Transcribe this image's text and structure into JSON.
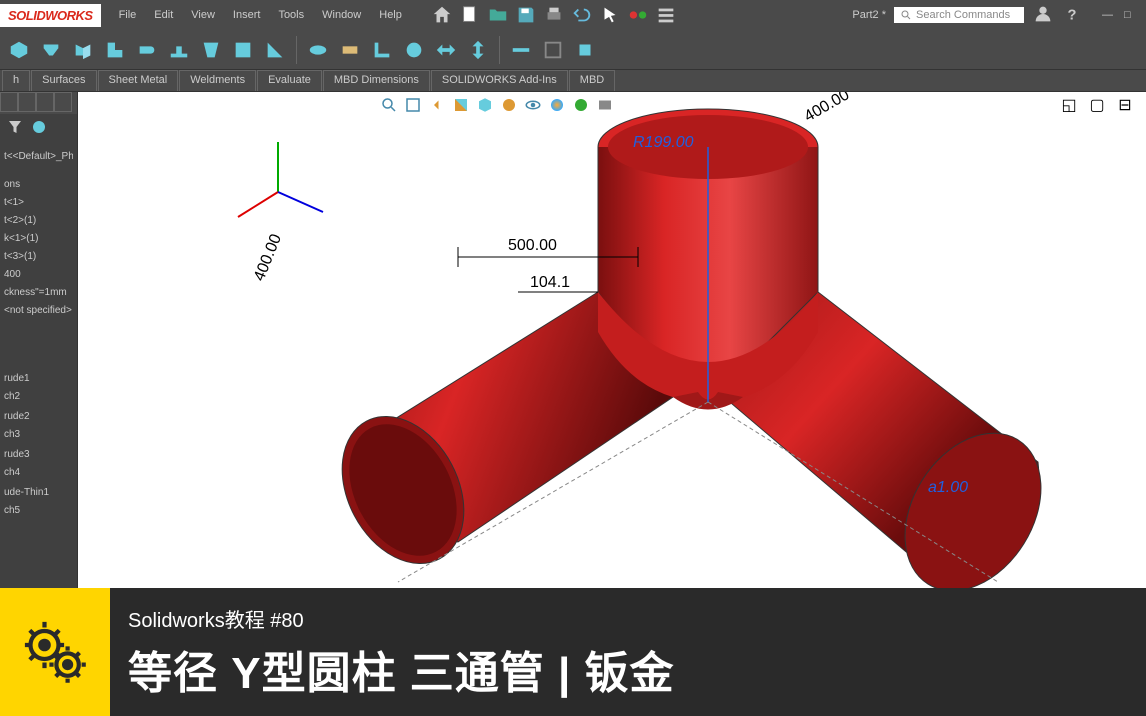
{
  "app": {
    "logo": "SOLIDWORKS",
    "doc": "Part2 *"
  },
  "menu": [
    "File",
    "Edit",
    "View",
    "Insert",
    "Tools",
    "Window",
    "Help"
  ],
  "search": {
    "placeholder": "Search Commands"
  },
  "tabs": [
    "h",
    "Surfaces",
    "Sheet Metal",
    "Weldments",
    "Evaluate",
    "MBD Dimensions",
    "SOLIDWORKS Add-Ins",
    "MBD"
  ],
  "tree": {
    "config": "t<<Default>_PhotoWo...",
    "items": [
      "ons",
      "t<1>",
      "t<2>(1)",
      "k<1>(1)",
      "t<3>(1)",
      "400",
      "ckness\"=1mm",
      "<not specified>"
    ],
    "features": [
      "rude1",
      "ch2",
      "",
      "rude2",
      "ch3",
      "",
      "rude3",
      "ch4",
      "",
      "ude-Thin1",
      "ch5"
    ]
  },
  "dimensions": {
    "d1": "500.00",
    "d2": "104.1",
    "d3": "R199.00",
    "d4": "400.00",
    "d5": "a1.00",
    "d6": "400.00"
  },
  "footer": {
    "sub": "Solidworks教程  #80",
    "main": "等径 Y型圆柱 三通管 | 钣金"
  },
  "colors": {
    "part": "#c41e1e",
    "partDark": "#8f1515",
    "accent": "#ffd500"
  }
}
